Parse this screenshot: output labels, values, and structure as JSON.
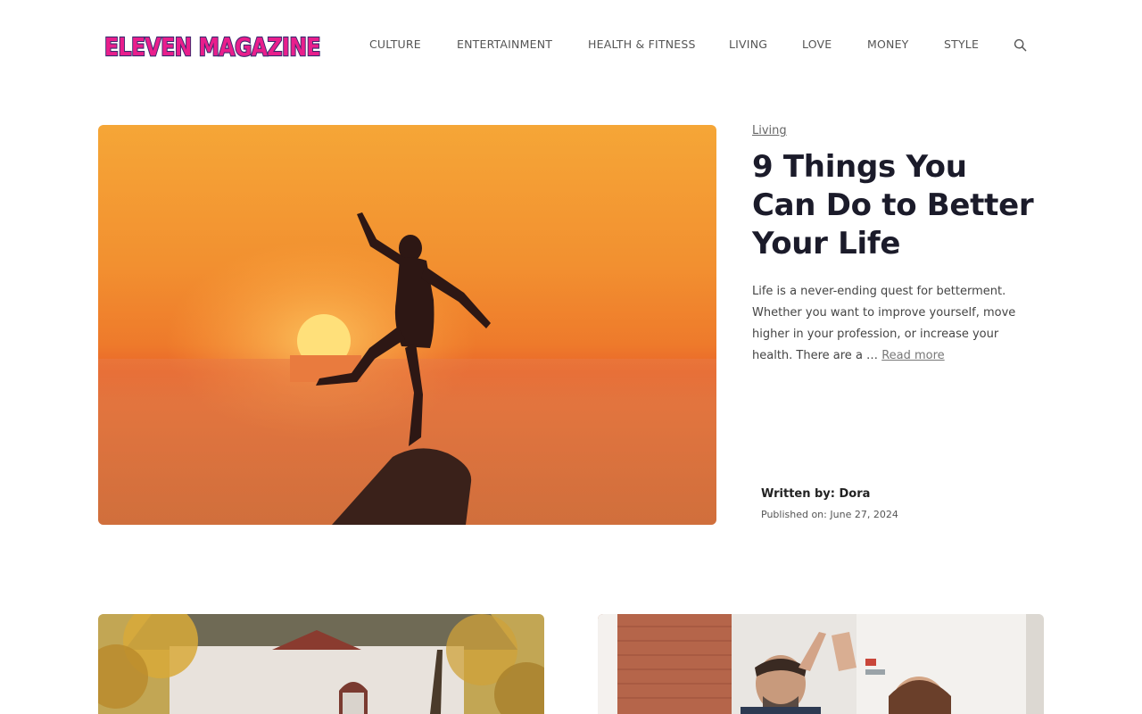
{
  "header": {
    "logo_text": "ELEVEN MAGAZINE",
    "nav": [
      {
        "label": "CULTURE"
      },
      {
        "label": "ENTERTAINMENT"
      },
      {
        "label": "HEALTH & FITNESS"
      },
      {
        "label": "LIVING"
      },
      {
        "label": "LOVE"
      },
      {
        "label": "MONEY"
      },
      {
        "label": "STYLE"
      }
    ],
    "search_icon": "search-icon"
  },
  "featured": {
    "category": "Living",
    "title": "9 Things You Can Do to Better Your Life",
    "excerpt": "Life is a never-ending quest for betterment. Whether you want to improve yourself, move higher in your profession, or increase your health. There are a …",
    "read_more": "Read more",
    "author_label": "Written by:",
    "author": "Dora",
    "published_label": "Published on:",
    "published_date": "June 27, 2024"
  },
  "colors": {
    "logo_fill": "#e91e8c",
    "logo_outline": "#3a2a6e",
    "sunset_orange": "#f2832a",
    "title_color": "#1b1b2a"
  }
}
